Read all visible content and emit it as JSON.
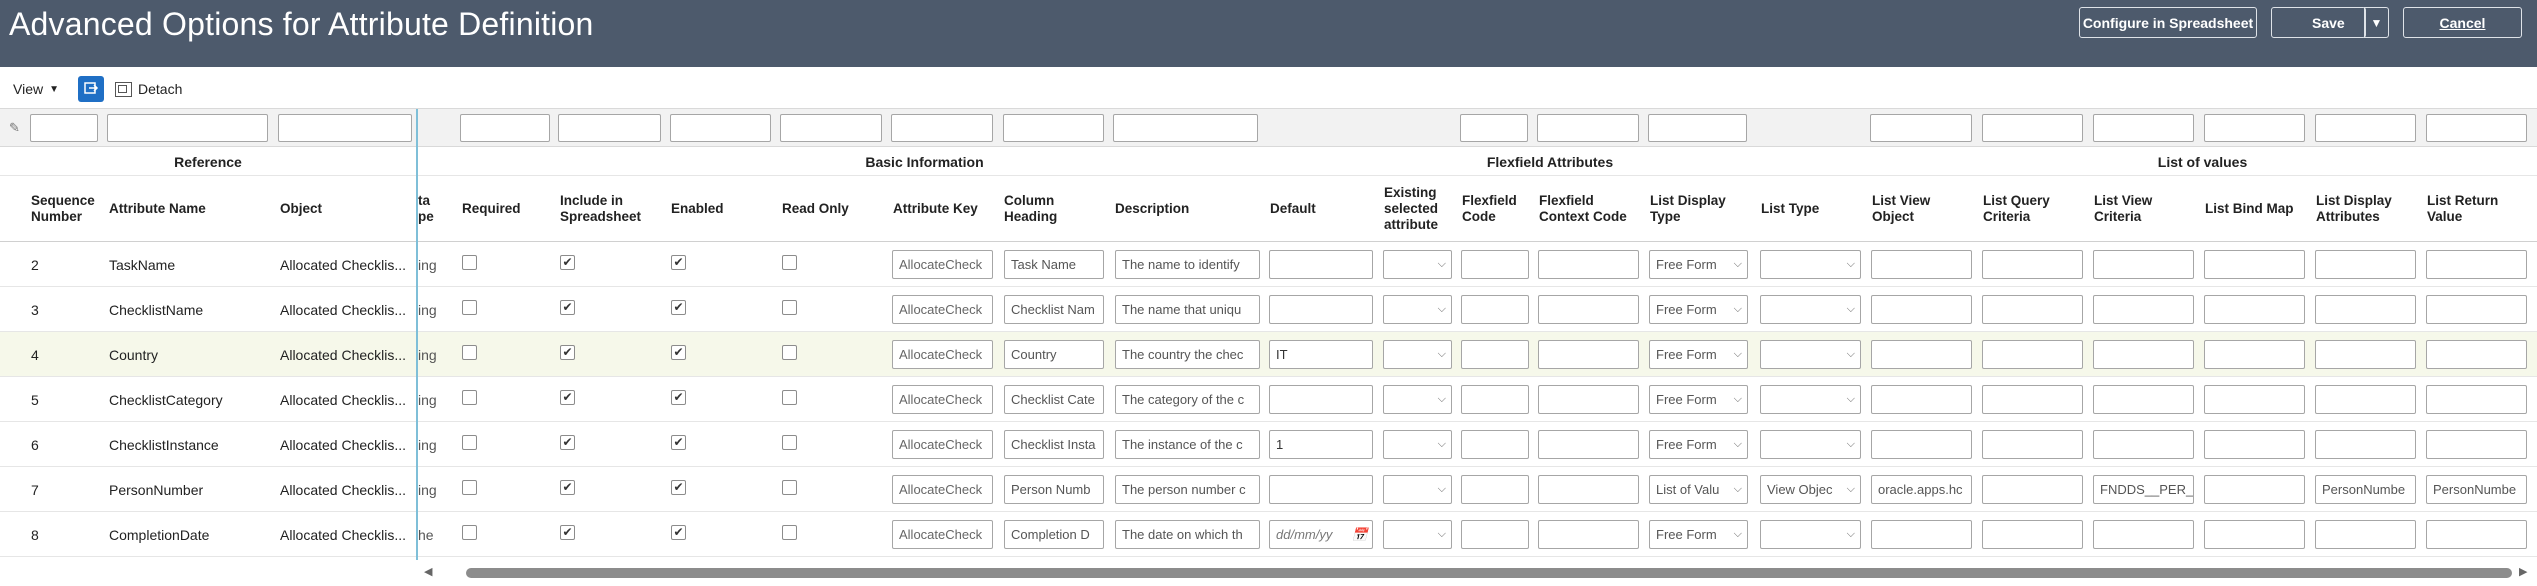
{
  "header": {
    "title": "Advanced Options for Attribute Definition",
    "configure_label": "Configure in Spreadsheet",
    "save_label": "Save",
    "cancel_label": "Cancel"
  },
  "toolbar": {
    "view_label": "View",
    "detach_label": "Detach"
  },
  "groups": {
    "reference": "Reference",
    "basic": "Basic Information",
    "flexfield": "Flexfield Attributes",
    "lov": "List of values"
  },
  "columns": {
    "seq": "Sequence Number",
    "attr_name": "Attribute Name",
    "object": "Object",
    "data_type": "ta\npe",
    "required": "Required",
    "include": "Include in Spreadsheet",
    "enabled": "Enabled",
    "read_only": "Read Only",
    "attr_key": "Attribute Key",
    "col_heading": "Column Heading",
    "description": "Description",
    "default": "Default",
    "existing": "Existing selected attribute",
    "ff_code": "Flexfield Code",
    "ff_ctx": "Flexfield Context Code",
    "list_display_type": "List Display Type",
    "list_type": "List Type",
    "lv_object": "List View Object",
    "lq_criteria": "List Query Criteria",
    "lv_criteria": "List View Criteria",
    "bind_map": "List Bind Map",
    "display_attrs": "List Display Attributes",
    "return_value": "List Return Value"
  },
  "rows": [
    {
      "seq": "2",
      "name": "TaskName",
      "object": "Allocated Checklis...",
      "dtype": "ing",
      "required": false,
      "include": true,
      "enabled": true,
      "read_only": false,
      "key": "AllocateCheck",
      "heading": "Task Name",
      "desc": "The name to identify",
      "default": "",
      "ldt": "Free Form",
      "list_type": "",
      "lvo": "",
      "lvc": "",
      "lda": "",
      "lrv": ""
    },
    {
      "seq": "3",
      "name": "ChecklistName",
      "object": "Allocated Checklis...",
      "dtype": "ing",
      "required": false,
      "include": true,
      "enabled": true,
      "read_only": false,
      "key": "AllocateCheck",
      "heading": "Checklist Nam",
      "desc": "The name that uniqu",
      "default": "",
      "ldt": "Free Form",
      "list_type": "",
      "lvo": "",
      "lvc": "",
      "lda": "",
      "lrv": ""
    },
    {
      "seq": "4",
      "name": "Country",
      "object": "Allocated Checklis...",
      "dtype": "ing",
      "required": false,
      "include": true,
      "enabled": true,
      "read_only": false,
      "key": "AllocateCheck",
      "heading": "Country",
      "desc": "The country the chec",
      "default": "IT",
      "ldt": "Free Form",
      "list_type": "",
      "lvo": "",
      "lvc": "",
      "lda": "",
      "lrv": ""
    },
    {
      "seq": "5",
      "name": "ChecklistCategory",
      "object": "Allocated Checklis...",
      "dtype": "ing",
      "required": false,
      "include": true,
      "enabled": true,
      "read_only": false,
      "key": "AllocateCheck",
      "heading": "Checklist Cate",
      "desc": "The category of the c",
      "default": "",
      "ldt": "Free Form",
      "list_type": "",
      "lvo": "",
      "lvc": "",
      "lda": "",
      "lrv": ""
    },
    {
      "seq": "6",
      "name": "ChecklistInstance",
      "object": "Allocated Checklis...",
      "dtype": "ing",
      "required": false,
      "include": true,
      "enabled": true,
      "read_only": false,
      "key": "AllocateCheck",
      "heading": "Checklist Insta",
      "desc": "The instance of the c",
      "default": "1",
      "ldt": "Free Form",
      "list_type": "",
      "lvo": "",
      "lvc": "",
      "lda": "",
      "lrv": ""
    },
    {
      "seq": "7",
      "name": "PersonNumber",
      "object": "Allocated Checklis...",
      "dtype": "ing",
      "required": false,
      "include": true,
      "enabled": true,
      "read_only": false,
      "key": "AllocateCheck",
      "heading": "Person Numb",
      "desc": "The person number c",
      "default": "",
      "ldt": "List of Valu",
      "list_type": "View Objec",
      "lvo": "oracle.apps.hc",
      "lvc": "FNDDS__PER_",
      "lda": "PersonNumbe",
      "lrv": "PersonNumbe"
    },
    {
      "seq": "8",
      "name": "CompletionDate",
      "object": "Allocated Checklis...",
      "dtype": "he",
      "required": false,
      "include": true,
      "enabled": true,
      "read_only": false,
      "key": "AllocateCheck",
      "heading": "Completion D",
      "desc": "The date on which th",
      "default": "dd/mm/yy",
      "ldt": "Free Form",
      "list_type": "",
      "lvo": "",
      "lvc": "",
      "lda": "",
      "lrv": ""
    }
  ]
}
